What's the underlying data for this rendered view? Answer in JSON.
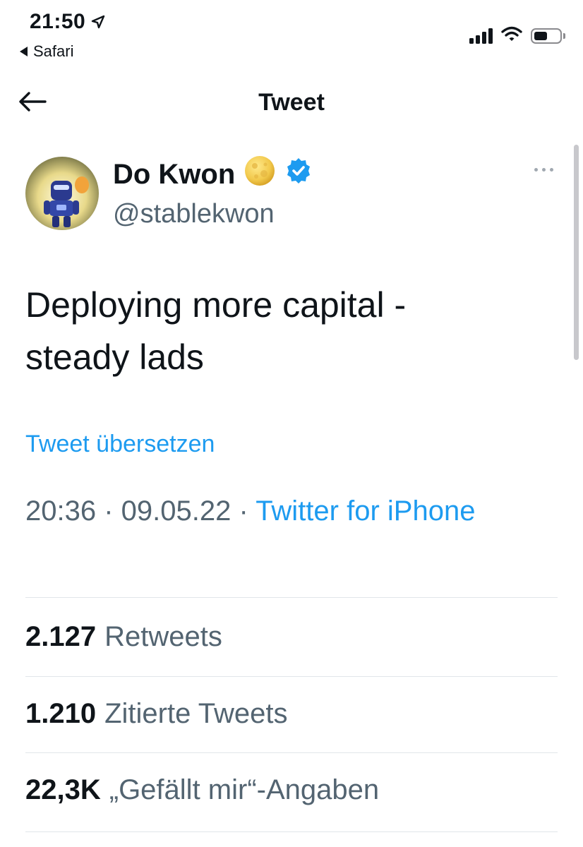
{
  "status_bar": {
    "time": "21:50",
    "back_to_app": "Safari"
  },
  "header": {
    "title": "Tweet"
  },
  "author": {
    "name": "Do Kwon",
    "handle": "@stablekwon"
  },
  "tweet": {
    "text_line1": "Deploying more capital -",
    "text_line2": "steady lads",
    "translate_label": "Tweet übersetzen",
    "time": "20:36",
    "separator": " · ",
    "date": "09.05.22",
    "source": "Twitter for iPhone"
  },
  "stats": [
    {
      "count": "2.127",
      "label": "Retweets"
    },
    {
      "count": "1.210",
      "label": "Zitierte Tweets"
    },
    {
      "count": "22,3K",
      "label": "„Gefällt mir“-Angaben"
    }
  ],
  "colors": {
    "accent": "#1d9bf0",
    "text_primary": "#0f1419",
    "text_secondary": "#536471",
    "verified": "#1d9bf0",
    "moon_emoji": "#f2c94c"
  },
  "icons": {
    "location": "location-arrow-icon",
    "signal": "cellular-signal-icon",
    "wifi": "wifi-icon",
    "battery": "battery-icon",
    "back": "back-arrow-icon",
    "moon": "full-moon-emoji-icon",
    "verified": "verified-badge-icon",
    "more": "more-options-icon"
  }
}
